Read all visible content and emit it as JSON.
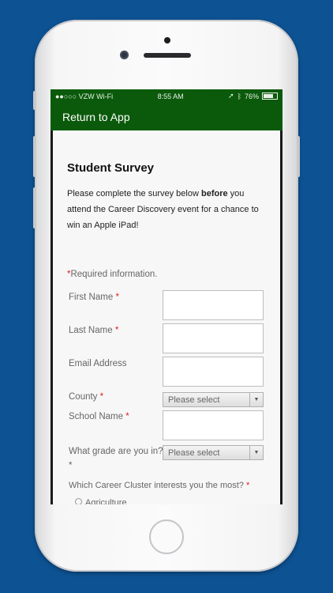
{
  "status_bar": {
    "carrier": "●●○○○ VZW Wi-Fi",
    "time": "8:55 AM",
    "battery": "76%"
  },
  "navbar": {
    "back_label": "Return to App"
  },
  "form": {
    "title": "Student Survey",
    "intro_before": "Please complete the survey below ",
    "intro_bold": "before",
    "intro_after": " you attend the Career Discovery event for a chance to win an Apple iPad!",
    "required_star": "*",
    "required_note": "Required information.",
    "first_name_label": "First Name",
    "last_name_label": "Last Name",
    "email_label": "Email Address",
    "county_label": "County",
    "county_value": "Please select",
    "school_label": "School Name",
    "grade_label": "What grade are you in?",
    "grade_value": "Please select",
    "cluster_label": "Which Career Cluster interests you the most?",
    "cluster_first_option": "Agriculture"
  },
  "colors": {
    "background": "#0d5394",
    "navbar": "#0b5a0b",
    "required": "#e02020"
  }
}
